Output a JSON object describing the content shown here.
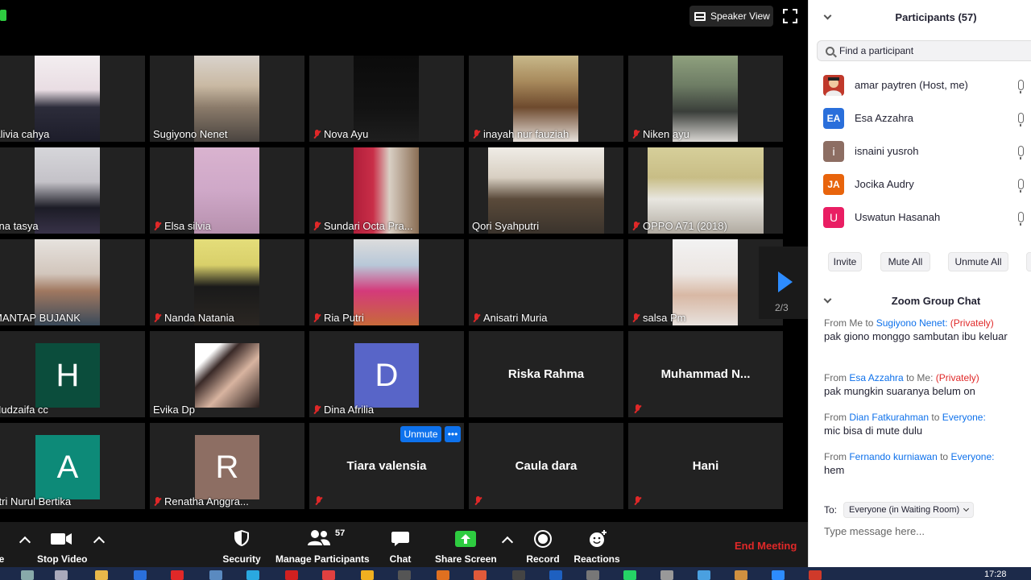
{
  "header": {
    "view_label": "Speaker View"
  },
  "grid": {
    "tiles": [
      {
        "name": "Alivia cahya",
        "muted": false
      },
      {
        "name": "Sugiyono Nenet",
        "muted": false
      },
      {
        "name": "Nova Ayu",
        "muted": true
      },
      {
        "name": "inayah nur fauziah",
        "muted": true
      },
      {
        "name": "Niken ayu",
        "muted": true
      },
      {
        "name": "fina tasya",
        "muted": false
      },
      {
        "name": "Elsa silvia",
        "muted": true
      },
      {
        "name": "Sundari Octa Pra...",
        "muted": true
      },
      {
        "name": "Qori Syahputri",
        "muted": false
      },
      {
        "name": "OPPO A71 (2018)",
        "muted": true
      },
      {
        "name": "MANTAP BUJANK",
        "muted": false
      },
      {
        "name": "Nanda Natania",
        "muted": true
      },
      {
        "name": "Ria Putri",
        "muted": true
      },
      {
        "name": "Anisatri Muria",
        "muted": true
      },
      {
        "name": "salsa Pm",
        "muted": true
      },
      {
        "name": "Hudzaifa cc",
        "muted": false,
        "initial": "H"
      },
      {
        "name": "Evika Dp",
        "muted": false
      },
      {
        "name": "Dina Afrilia",
        "muted": true,
        "initial": "D"
      },
      {
        "name": "Riska Rahma",
        "muted": false
      },
      {
        "name": "Muhammad  N...",
        "muted": true
      },
      {
        "name": "stri Nurul Bertika",
        "muted": false,
        "initial": "A"
      },
      {
        "name": "Renatha Anggra...",
        "muted": true,
        "initial": "R"
      },
      {
        "name": "Tiara valensia",
        "muted": true
      },
      {
        "name": "Caula dara",
        "muted": true
      },
      {
        "name": "Hani",
        "muted": true
      }
    ],
    "unmute_label": "Unmute",
    "more_label": "•••",
    "page_indicator": "2/3"
  },
  "toolbar": {
    "stop_video": "Stop Video",
    "security": "Security",
    "manage_participants": "Manage Participants",
    "participant_count": "57",
    "chat": "Chat",
    "share_screen": "Share Screen",
    "record": "Record",
    "reactions": "Reactions",
    "end_meeting": "End Meeting",
    "left_cut_label": "e"
  },
  "participants_panel": {
    "title": "Participants (57)",
    "search_placeholder": "Find a participant",
    "list": [
      {
        "name": "amar paytren (Host, me)",
        "initials": "",
        "color": "#c0392b"
      },
      {
        "name": "Esa Azzahra",
        "initials": "EA",
        "color": "#2a6fdb"
      },
      {
        "name": "isnaini yusroh",
        "initials": "i",
        "color": "#8d6e63"
      },
      {
        "name": "Jocika Audry",
        "initials": "JA",
        "color": "#e8640c"
      },
      {
        "name": "Uswatun Hasanah",
        "initials": "U",
        "color": "#e91e63"
      }
    ],
    "invite": "Invite",
    "mute_all": "Mute All",
    "unmute_all": "Unmute All"
  },
  "chat": {
    "title": "Zoom Group Chat",
    "messages": [
      {
        "from": "From",
        "sender": "Me",
        "to_word": "to",
        "recipient": "Sugiyono Nenet:",
        "privacy": "(Privately)",
        "text": "pak giono monggo sambutan ibu keluar"
      },
      {
        "from": "From",
        "sender": "Esa Azzahra",
        "to_word": "to",
        "recipient": "Me:",
        "privacy": "(Privately)",
        "text": "pak mungkin suaranya belum on"
      },
      {
        "from": "From",
        "sender": "Dian Fatkurahman",
        "to_word": "to",
        "recipient": "Everyone:",
        "privacy": "",
        "text": "mic bisa di mute dulu"
      },
      {
        "from": "From",
        "sender": "Fernando kurniawan",
        "to_word": "to",
        "recipient": "Everyone:",
        "privacy": "",
        "text": "hem"
      }
    ],
    "to_label": "To:",
    "to_value": "Everyone (in Waiting Room)",
    "input_placeholder": "Type message here..."
  },
  "taskbar": {
    "time": "17:28"
  },
  "colors": {
    "zoom_blue": "#0e72ed",
    "muted_red": "#e02828",
    "end_red": "#e02828"
  }
}
